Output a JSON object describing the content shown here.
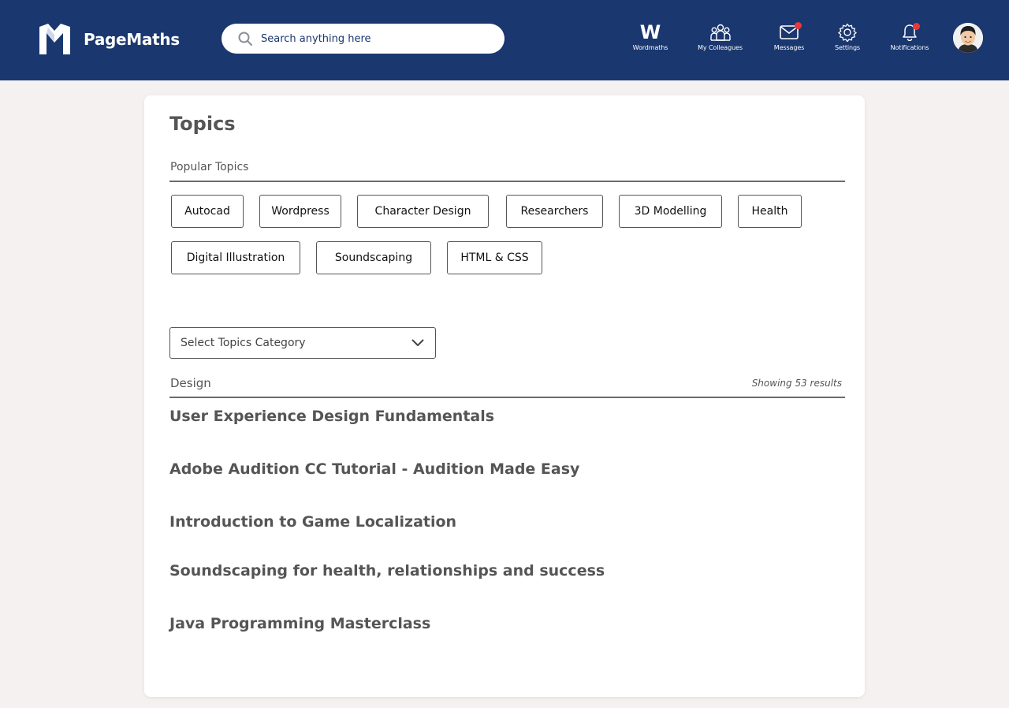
{
  "brand": {
    "name": "PageMaths"
  },
  "search": {
    "placeholder": "Search anything here"
  },
  "nav": [
    {
      "label": "Wordmaths",
      "icon": "w-letter-icon"
    },
    {
      "label": "My Colleagues",
      "icon": "colleagues-icon"
    },
    {
      "label": "Messages",
      "icon": "envelope-icon",
      "badge": true
    },
    {
      "label": "Settings",
      "icon": "gear-icon"
    },
    {
      "label": "Notifications",
      "icon": "bell-icon",
      "badge": true
    }
  ],
  "nav_w_letter": "W",
  "colors": {
    "header": "#1a376f",
    "badge": "#e8383b",
    "background": "#f5f1f0"
  },
  "page": {
    "title": "Topics",
    "popular_label": "Popular Topics",
    "popular_topics": [
      "Autocad",
      "Wordpress",
      "Character Design",
      "Researchers",
      "3D Modelling",
      "Health",
      "Digital Illustration",
      "Soundscaping",
      "HTML & CSS"
    ],
    "category_select": {
      "value": "Select Topics Category"
    },
    "category_name": "Design",
    "results_text": "Showing 53 results",
    "courses": [
      "User Experience Design Fundamentals",
      "Adobe Audition CC Tutorial - Audition Made Easy",
      "Introduction to Game Localization",
      "Soundscaping for health, relationships and success",
      "Java Programming Masterclass"
    ]
  }
}
